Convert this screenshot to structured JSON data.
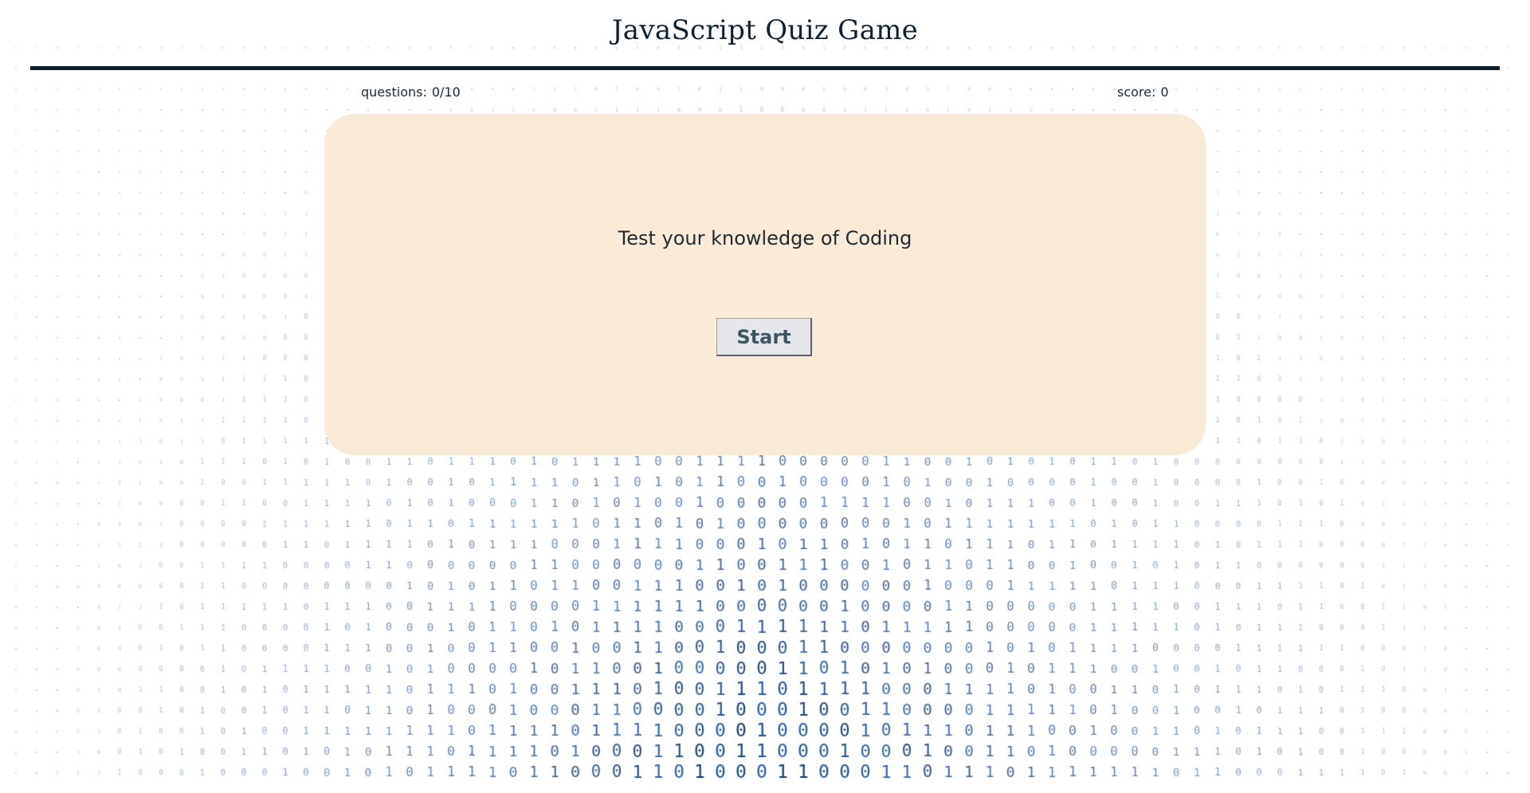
{
  "app": {
    "title": "JavaScript Quiz Game"
  },
  "stats": {
    "questions_label": "questions:",
    "questions_value": "0/10",
    "score_label": "score:",
    "score_value": "0"
  },
  "card": {
    "subtitle": "Test your knowledge of Coding",
    "start_label": "Start"
  },
  "colors": {
    "title_text": "#0e2233",
    "rule": "#0c1f2c",
    "card_background": "#f9ebd7",
    "button_background": "#e4e6ea",
    "button_text": "#3c555e",
    "binary_digits": "#1f4a70"
  },
  "background": {
    "pattern": "binary-digits-0-1"
  }
}
